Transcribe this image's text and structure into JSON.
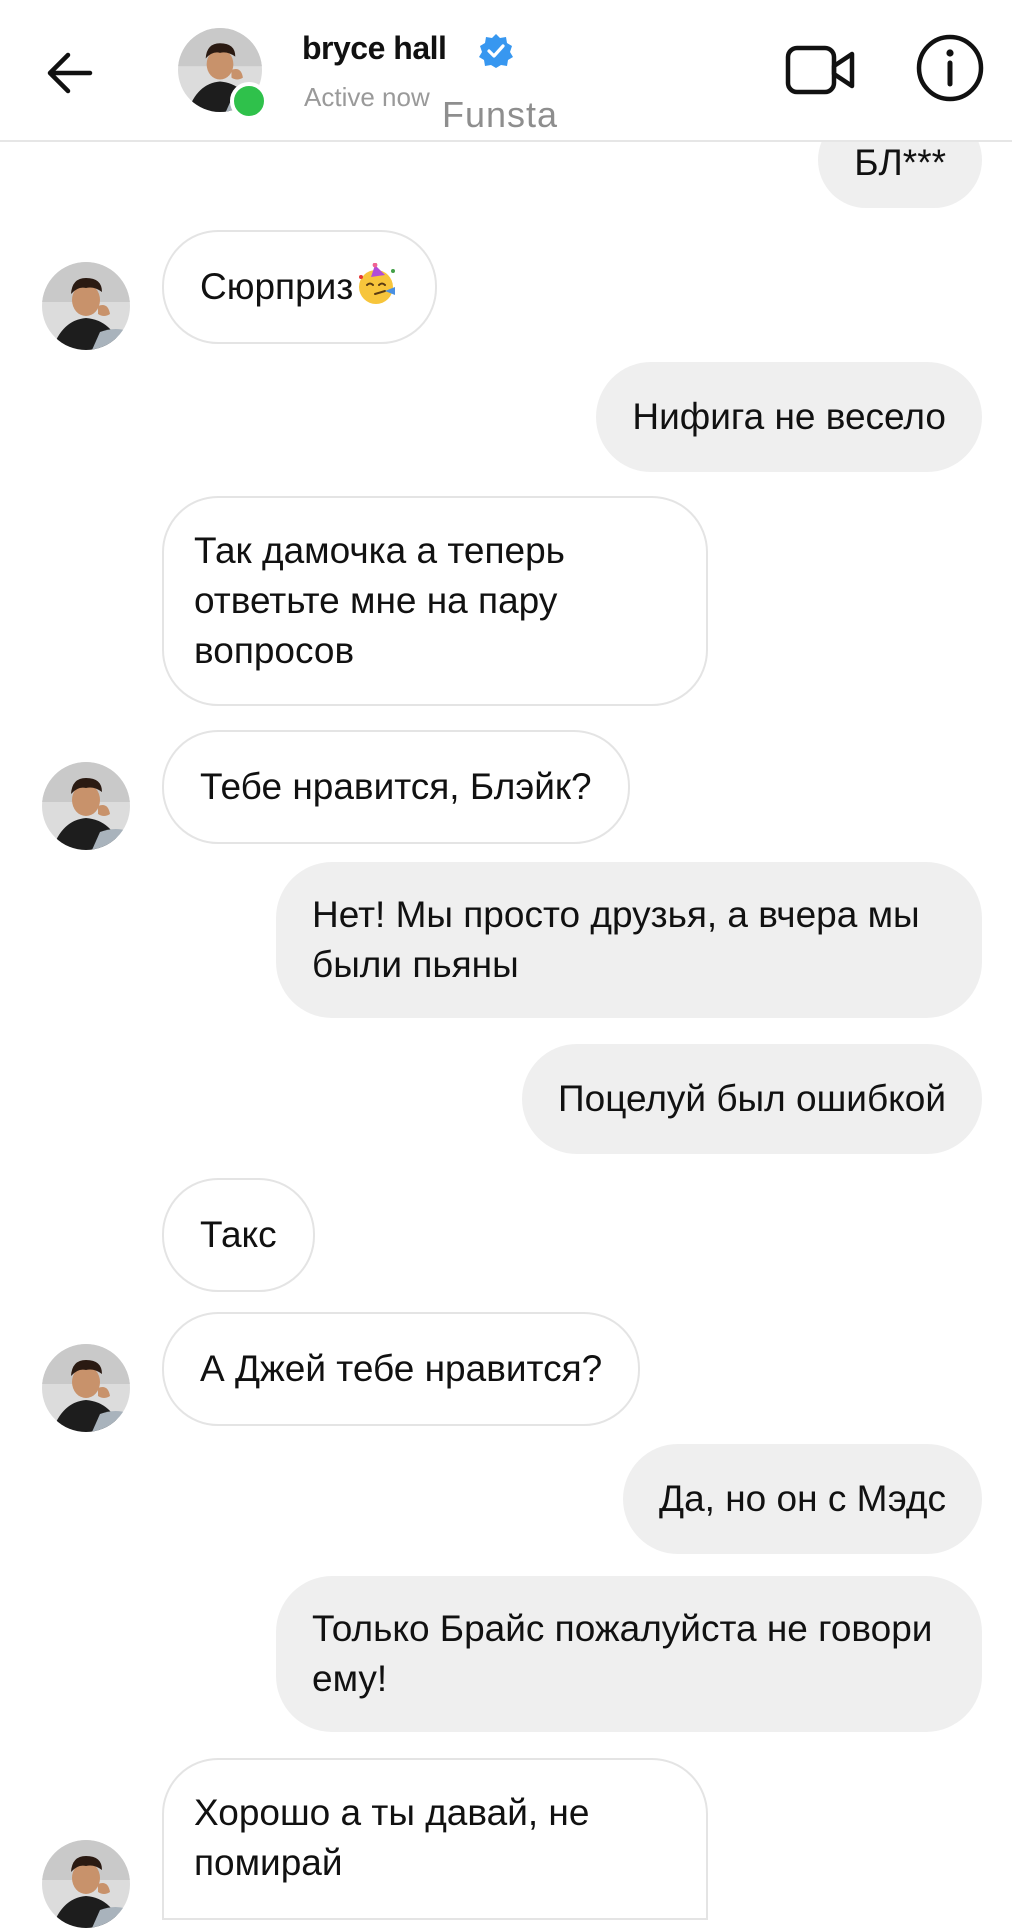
{
  "header": {
    "contact_name": "bryce hall",
    "status": "Active now",
    "watermark": "Funsta",
    "icons": {
      "back": "back-arrow-icon",
      "video": "video-call-icon",
      "info": "info-icon",
      "verified": "verified-badge-icon"
    }
  },
  "colors": {
    "active": "#2fc14b",
    "verified": "#3797f0",
    "outgoing_bubble": "#efefef",
    "incoming_border": "#e4e4e4"
  },
  "messages": [
    {
      "from": "me",
      "text": "БЛ***"
    },
    {
      "from": "them",
      "text": "Сюрприз"
    },
    {
      "from": "me",
      "text": "Нифига не весело"
    },
    {
      "from": "them",
      "text": "Так дамочка а теперь ответьте мне на пару вопросов"
    },
    {
      "from": "them",
      "text": "Тебе нравится, Блэйк?"
    },
    {
      "from": "me",
      "text": "Нет! Мы просто друзья, а вчера мы были пьяны"
    },
    {
      "from": "me",
      "text": "Поцелуй был ошибкой"
    },
    {
      "from": "them",
      "text": "Такс"
    },
    {
      "from": "them",
      "text": "А Джей тебе нравится?"
    },
    {
      "from": "me",
      "text": "Да, но он с Мэдс"
    },
    {
      "from": "me",
      "text": "Только Брайс пожалуйста не говори ему!"
    },
    {
      "from": "them",
      "text": "Хорошо а ты давай, не помирай"
    }
  ]
}
